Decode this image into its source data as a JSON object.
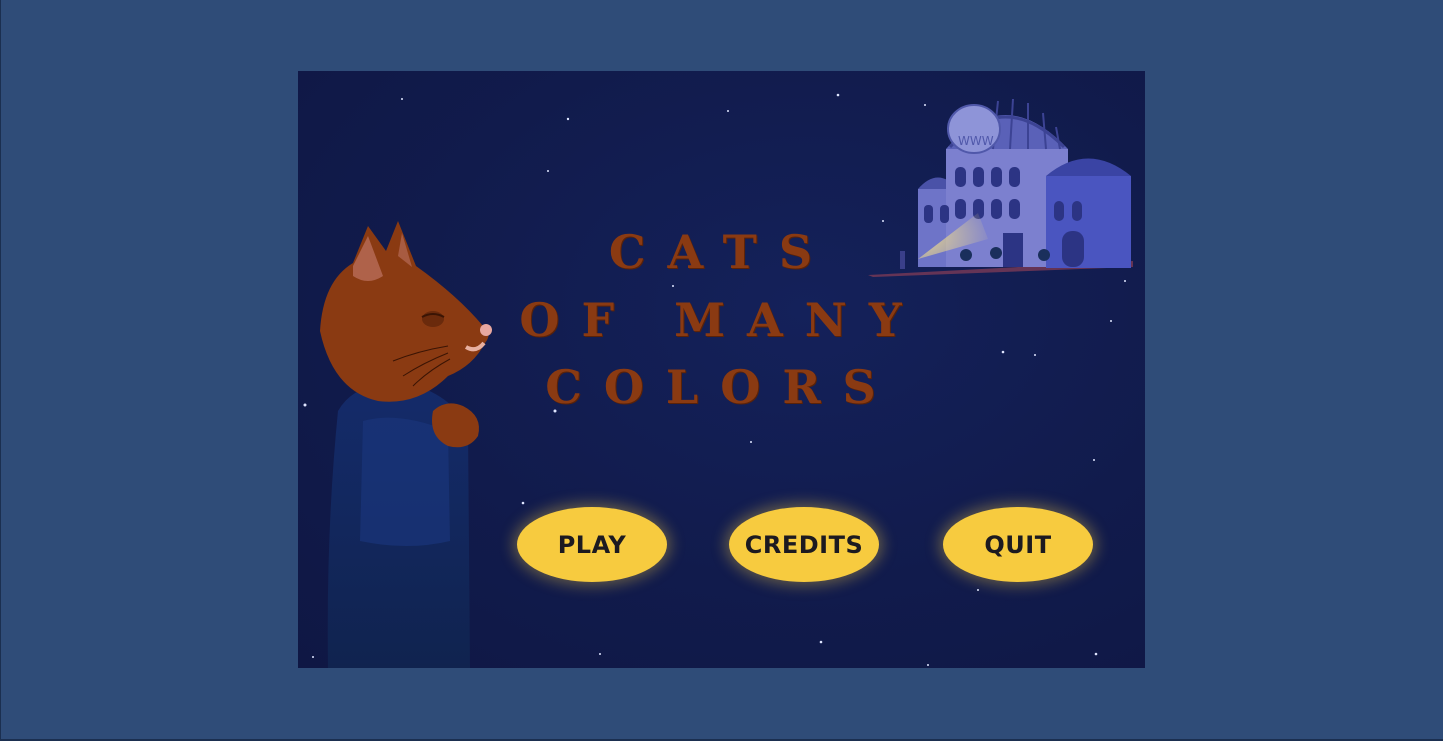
{
  "game": {
    "title_lines": [
      "CATS",
      "OF MANY",
      "COLORS"
    ],
    "menu": {
      "play_label": "PLAY",
      "credits_label": "CREDITS",
      "quit_label": "QUIT"
    },
    "building_sign": "WWW",
    "colors": {
      "window_frame": "#2f4c78",
      "sky": "#111b4c",
      "title": "#8a3a12",
      "button": "#f7cb3f",
      "button_text": "#1c1a20"
    }
  }
}
